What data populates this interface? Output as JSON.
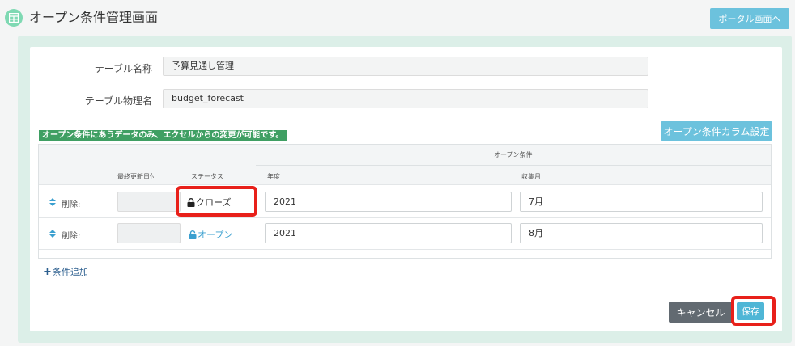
{
  "header": {
    "title": "オープン条件管理画面",
    "portal_button": "ポータル画面へ",
    "app_icon": "table-grid-icon"
  },
  "form": {
    "table_name_label": "テーブル名称",
    "table_name_value": "予算見通し管理",
    "physical_name_label": "テーブル物理名",
    "physical_name_value": "budget_forecast"
  },
  "notice": "オープン条件にあうデータのみ、エクセルからの変更が可能です。",
  "column_settings_button": "オープン条件カラム設定",
  "table": {
    "group_header": "オープン条件",
    "columns": {
      "last_updated": "最終更新日付",
      "status": "ステータス",
      "year": "年度",
      "month": "収集月"
    },
    "rows": [
      {
        "delete_label": "削除:",
        "last_updated": "",
        "status": "クローズ",
        "status_icon": "lock-icon",
        "year": "2021",
        "month": "7月"
      },
      {
        "delete_label": "削除:",
        "last_updated": "",
        "status": "オープン",
        "status_icon": "unlock-icon",
        "year": "2021",
        "month": "8月"
      }
    ]
  },
  "add_condition": "条件追加",
  "footer": {
    "cancel": "キャンセル",
    "save": "保存"
  },
  "colors": {
    "accent": "#6cc2dd",
    "notice": "#3f9f63",
    "highlight": "#e8201a",
    "open_status": "#3a9fcf"
  }
}
